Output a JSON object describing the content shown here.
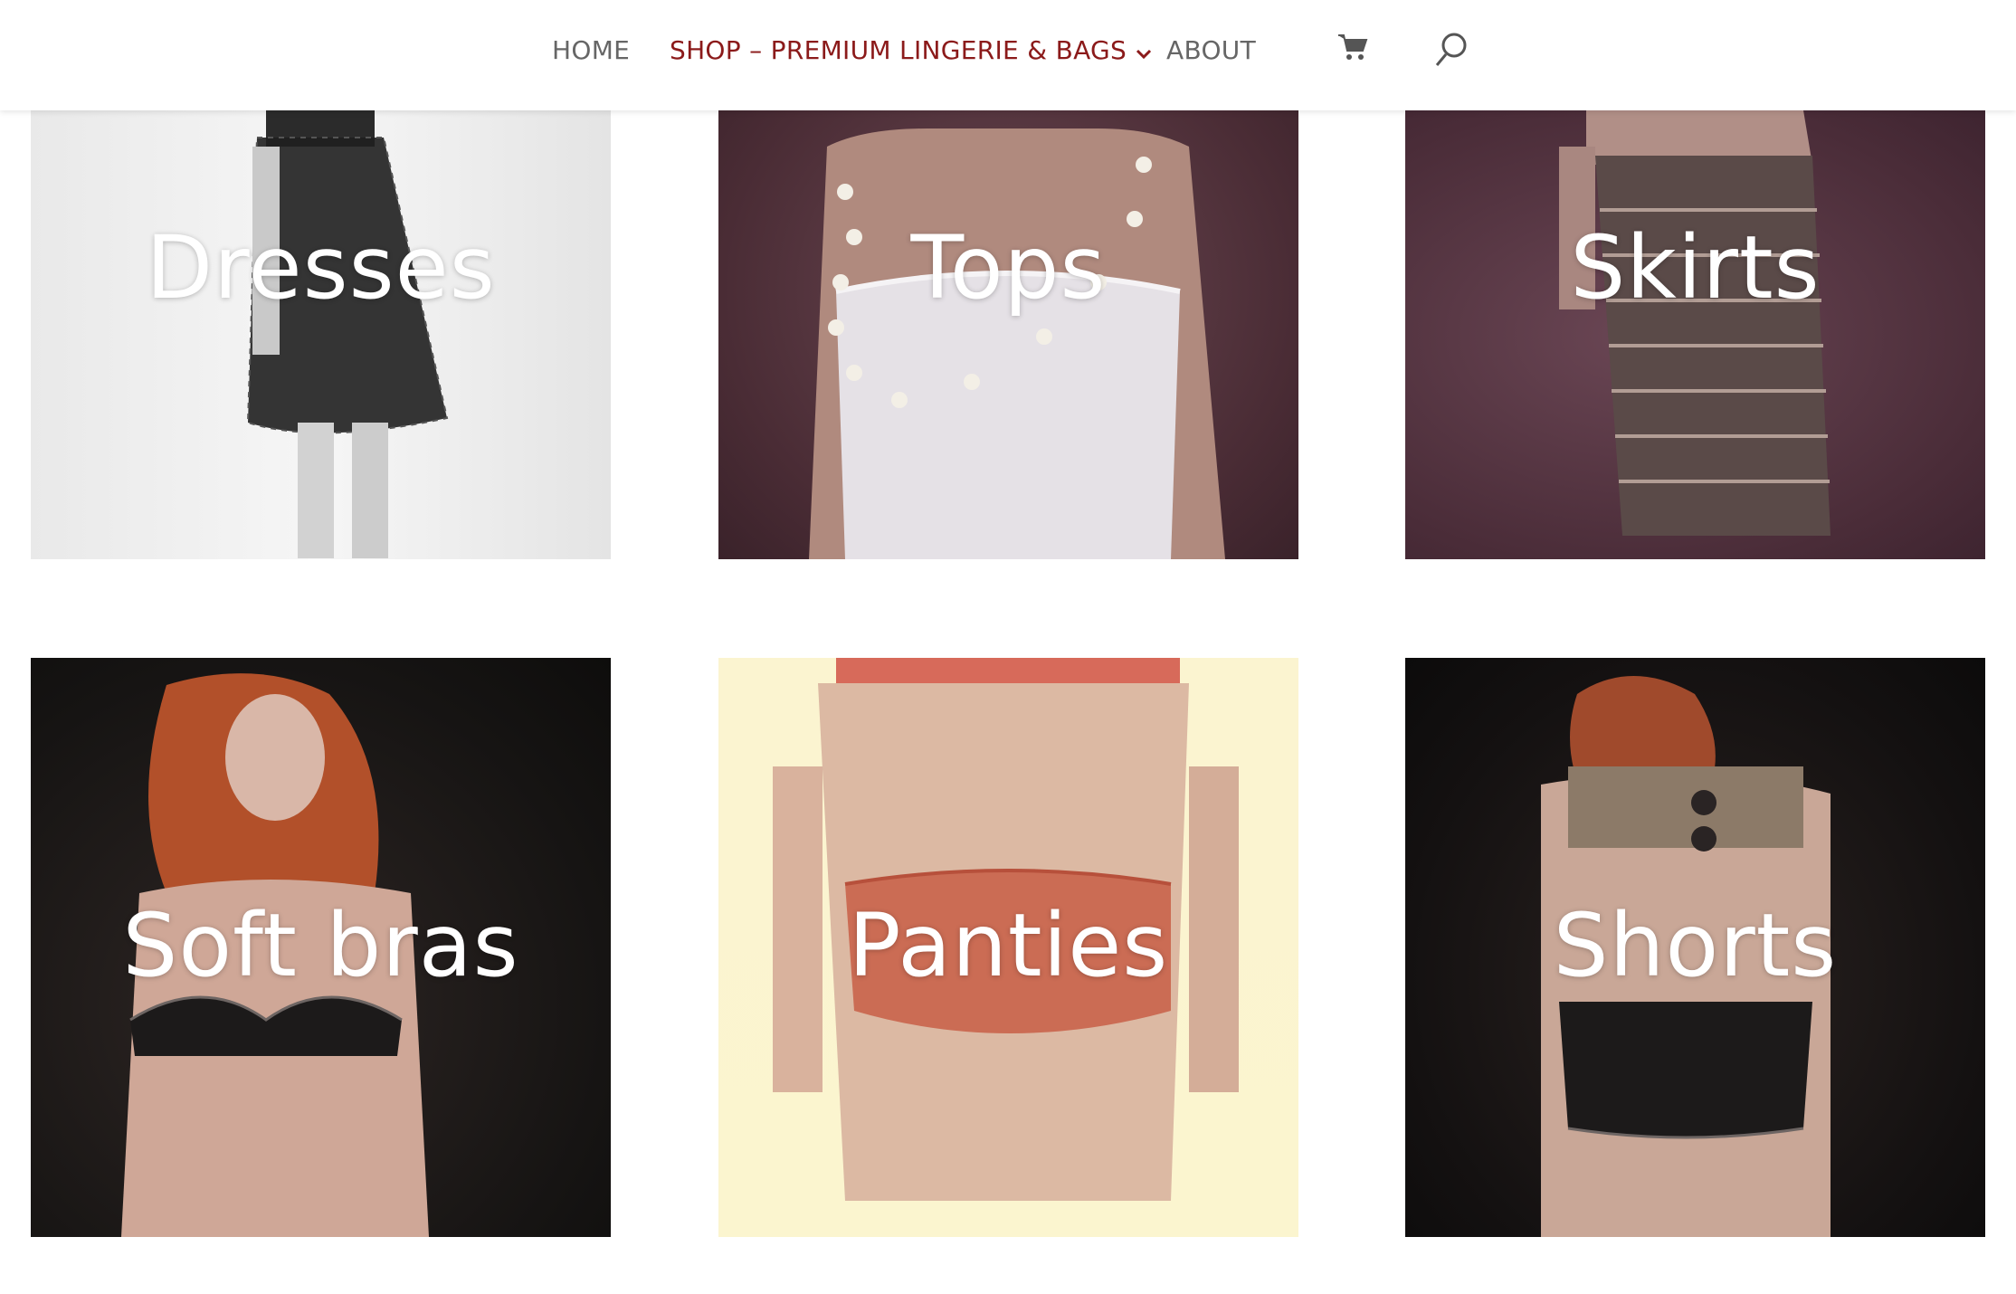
{
  "nav": {
    "items": [
      {
        "label": "HOME"
      },
      {
        "label": "SHOP – PREMIUM LINGERIE & BAGS"
      },
      {
        "label": "ABOUT"
      }
    ],
    "active_color": "#8b1a1a",
    "cart_icon": "cart-icon",
    "search_icon": "search-icon"
  },
  "categories": [
    {
      "label": "Dresses"
    },
    {
      "label": "Tops"
    },
    {
      "label": "Skirts"
    },
    {
      "label": "Soft bras"
    },
    {
      "label": "Panties"
    },
    {
      "label": "Shorts"
    }
  ]
}
